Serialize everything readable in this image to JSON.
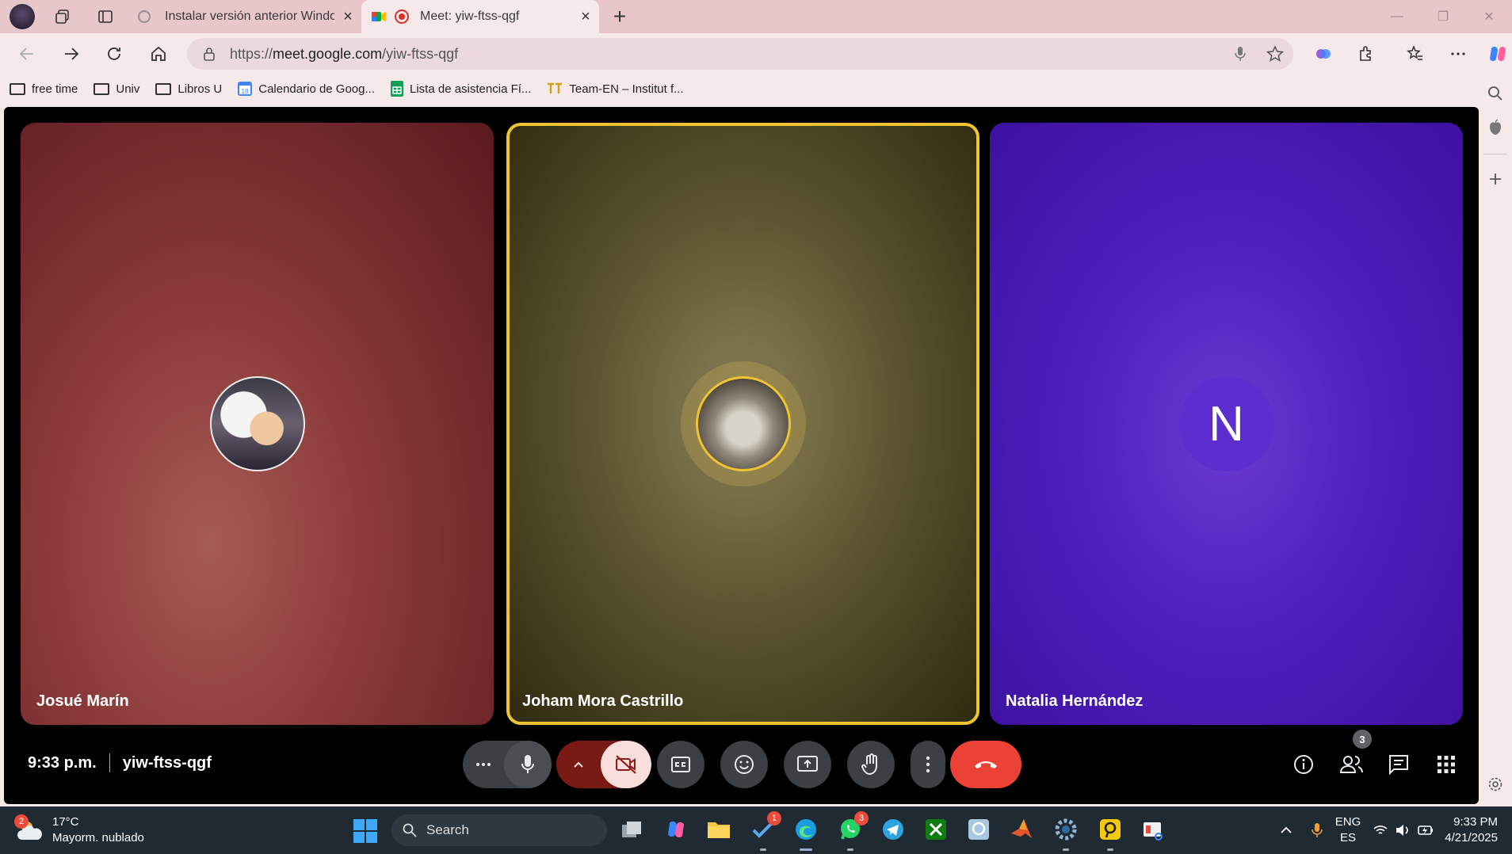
{
  "browser": {
    "tabs": [
      {
        "title": "Instalar versión anterior Windows",
        "active": false
      },
      {
        "title": "Meet: yiw-ftss-qgf",
        "active": true
      }
    ],
    "url_prefix": "https://",
    "url_host": "meet.google.com",
    "url_path": "/yiw-ftss-qgf"
  },
  "bookmarks": [
    {
      "label": "free time",
      "icon": "folder-icon"
    },
    {
      "label": "Univ",
      "icon": "folder-icon"
    },
    {
      "label": "Libros U",
      "icon": "folder-icon"
    },
    {
      "label": "Calendario de Goog...",
      "icon": "google-calendar-icon"
    },
    {
      "label": "Lista de asistencia Fí...",
      "icon": "google-sheets-icon"
    },
    {
      "label": "Team-EN – Institut f...",
      "icon": "team-en-icon"
    }
  ],
  "meet": {
    "participants": [
      {
        "name": "Josué Marín",
        "avatar": "anime-avatar"
      },
      {
        "name": "Joham Mora Castrillo",
        "avatar": "cat-photo",
        "speaking": true
      },
      {
        "name": "Natalia Hernández",
        "avatar_letter": "N"
      }
    ],
    "time": "9:33 p.m.",
    "meeting_code": "yiw-ftss-qgf",
    "people_count": "3",
    "colors": {
      "speaking_border": "#f1c232",
      "hangup": "#ea4335",
      "cam_off": "#f9dedc"
    }
  },
  "taskbar": {
    "weather_badge": "2",
    "temperature": "17°C",
    "weather_desc": "Mayorm. nublado",
    "search_label": "Search",
    "todo_badge": "1",
    "whatsapp_badge": "3",
    "lang_primary": "ENG",
    "lang_secondary": "ES",
    "time": "9:33 PM",
    "date": "4/21/2025"
  }
}
